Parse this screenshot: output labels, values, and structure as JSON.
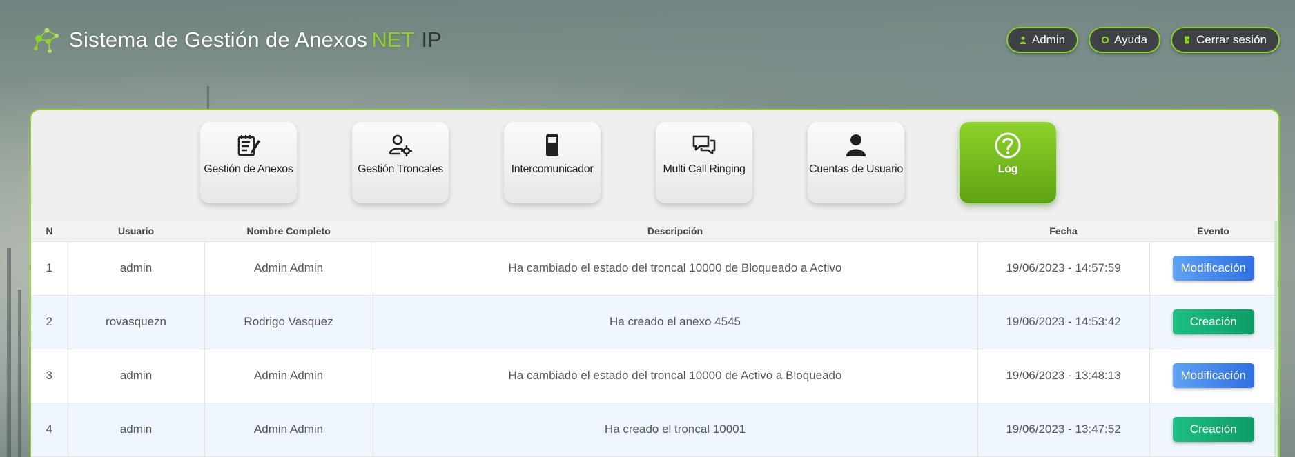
{
  "header": {
    "title": "Sistema de Gestión de Anexos",
    "title_net": "NET",
    "title_ip": "IP",
    "buttons": [
      {
        "label": "Admin",
        "icon": "user-icon"
      },
      {
        "label": "Ayuda",
        "icon": "help-icon"
      },
      {
        "label": "Cerrar sesión",
        "icon": "door-icon"
      }
    ]
  },
  "nav": {
    "items": [
      {
        "label": "Gestión de Anexos",
        "icon": "notepad-icon",
        "active": false
      },
      {
        "label": "Gestión Troncales",
        "icon": "user-gear-icon",
        "active": false
      },
      {
        "label": "Intercomunicador",
        "icon": "phone-icon",
        "active": false
      },
      {
        "label": "Multi Call Ringing",
        "icon": "chat-bubbles-icon",
        "active": false
      },
      {
        "label": "Cuentas de Usuario",
        "icon": "person-icon",
        "active": false
      },
      {
        "label": "Log",
        "icon": "question-circle-icon",
        "active": true
      }
    ]
  },
  "table": {
    "columns": [
      "N",
      "Usuario",
      "Nombre Completo",
      "Descripción",
      "Fecha",
      "Evento"
    ],
    "rows": [
      {
        "n": "1",
        "usuario": "admin",
        "nombre": "Admin Admin",
        "descripcion": "Ha cambiado el estado del troncal 10000 de Bloqueado a Activo",
        "fecha": "19/06/2023 - 14:57:59",
        "evento": "Modificación"
      },
      {
        "n": "2",
        "usuario": "rovasquezn",
        "nombre": "Rodrigo Vasquez",
        "descripcion": "Ha creado el anexo 4545",
        "fecha": "19/06/2023 - 14:53:42",
        "evento": "Creación"
      },
      {
        "n": "3",
        "usuario": "admin",
        "nombre": "Admin Admin",
        "descripcion": "Ha cambiado el estado del troncal 10000 de Activo a Bloqueado",
        "fecha": "19/06/2023 - 13:48:13",
        "evento": "Modificación"
      },
      {
        "n": "4",
        "usuario": "admin",
        "nombre": "Admin Admin",
        "descripcion": "Ha creado el troncal 10001",
        "fecha": "19/06/2023 - 13:47:52",
        "evento": "Creación"
      }
    ]
  },
  "colors": {
    "accent": "#8ed12a",
    "modificacion": "#2f6fe0",
    "creacion": "#0d9c66"
  }
}
